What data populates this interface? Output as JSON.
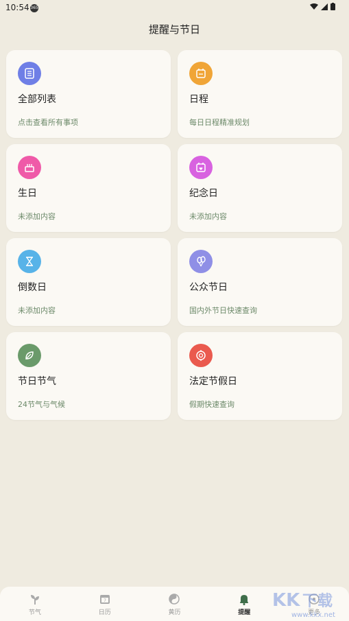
{
  "status": {
    "time": "10:54",
    "app_badge": "365"
  },
  "title": "提醒与节日",
  "cards": [
    {
      "title": "全部列表",
      "subtitle": "点击查看所有事项",
      "icon": "list-icon",
      "color": "#6f7fe6"
    },
    {
      "title": "日程",
      "subtitle": "每日日程精准规划",
      "icon": "calendar-icon",
      "color": "#f0a537"
    },
    {
      "title": "生日",
      "subtitle": "未添加内容",
      "icon": "cake-icon",
      "color": "#ef5aa8"
    },
    {
      "title": "纪念日",
      "subtitle": "未添加内容",
      "icon": "calendar-heart-icon",
      "color": "#d862e0"
    },
    {
      "title": "倒数日",
      "subtitle": "未添加内容",
      "icon": "hourglass-icon",
      "color": "#58b3e8"
    },
    {
      "title": "公众节日",
      "subtitle": "国内外节日快速查询",
      "icon": "balloon-icon",
      "color": "#8f8fe6"
    },
    {
      "title": "节日节气",
      "subtitle": "24节气与气候",
      "icon": "leaf-icon",
      "color": "#6a9a6a"
    },
    {
      "title": "法定节假日",
      "subtitle": "假期快速查询",
      "icon": "badge-icon",
      "color": "#ea5a4e"
    }
  ],
  "nav": [
    {
      "label": "节气",
      "icon": "plant-icon"
    },
    {
      "label": "日历",
      "icon": "calendar-icon"
    },
    {
      "label": "黄历",
      "icon": "yin-yang-icon"
    },
    {
      "label": "提醒",
      "icon": "bell-icon",
      "active": true
    },
    {
      "label": "更多",
      "icon": "more-icon"
    }
  ],
  "watermark": {
    "text": "KK下载",
    "url": "www.kkx.net"
  }
}
